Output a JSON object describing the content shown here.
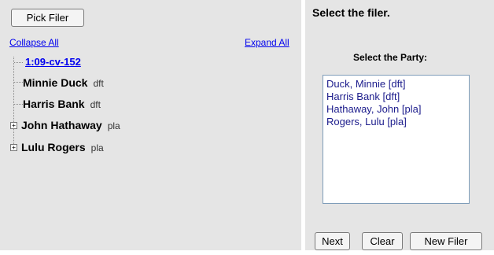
{
  "left_panel": {
    "pick_filer_label": "Pick Filer",
    "collapse_all": "Collapse All",
    "expand_all": "Expand All",
    "case_number": "1:09-cv-152",
    "parties": [
      {
        "name": "Minnie Duck",
        "role": "dft",
        "expandable": false
      },
      {
        "name": "Harris Bank",
        "role": "dft",
        "expandable": false
      },
      {
        "name": "John Hathaway",
        "role": "pla",
        "expandable": true
      },
      {
        "name": "Lulu Rogers",
        "role": "pla",
        "expandable": true
      }
    ]
  },
  "right_panel": {
    "title": "Select the filer.",
    "subtitle": "Select the Party:",
    "options": [
      "Duck, Minnie  [dft]",
      "Harris Bank  [dft]",
      "Hathaway, John  [pla]",
      "Rogers, Lulu  [pla]"
    ],
    "buttons": {
      "next": "Next",
      "clear": "Clear",
      "new_filer": "New Filer"
    }
  },
  "icons": {
    "expand": "plus-box-icon"
  }
}
